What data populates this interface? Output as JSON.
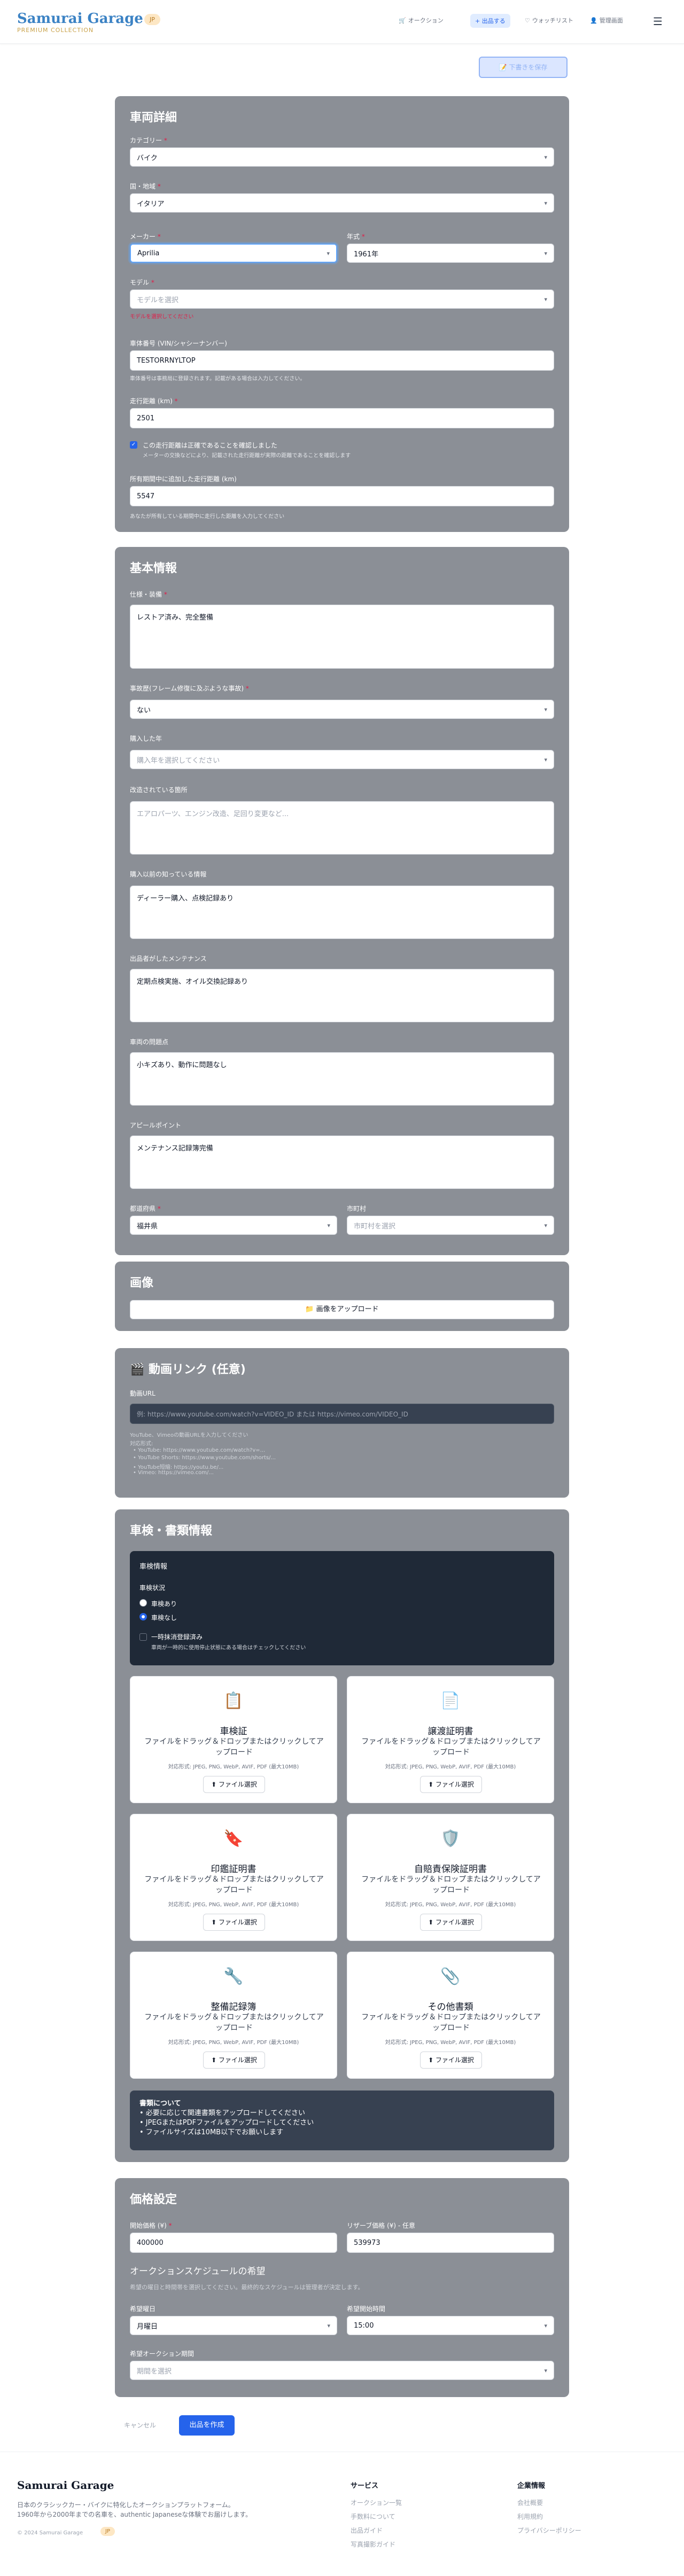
{
  "header": {
    "logo": "Samurai Garage",
    "subtitle": "PREMIUM COLLECTION",
    "badge": "JP",
    "nav": [
      {
        "icon": "🛒",
        "label": "オークション"
      },
      {
        "icon": "+",
        "label": "出品する"
      },
      {
        "icon": "♡",
        "label": "ウォッチリスト"
      },
      {
        "icon": "👤",
        "label": "管理画面"
      }
    ],
    "menu_icon": "☰"
  },
  "draft_button": "📝 下書きを保存",
  "vehicle": {
    "title": "車両詳細",
    "category_label": "カテゴリー",
    "category": "バイク",
    "country_label": "国・地域",
    "country": "イタリア",
    "maker_label": "メーカー",
    "maker": "Aprilia",
    "year_label": "年式",
    "year": "1961年",
    "model_label": "モデル",
    "model_placeholder": "モデルを選択",
    "model_error": "モデルを選択してください",
    "vin_label": "車体番号 (VIN/シャシーナンバー)",
    "vin": "TESTORRNYLTOP",
    "vin_hint": "車体番号は事務局に登録されます。記載がある場合は入力してください。",
    "mileage_label": "走行距離 (km)",
    "mileage": "2501",
    "confirm_label": "この走行距離は正確であることを確認しました",
    "confirm_hint": "メーターの交換などにより、記載された走行距離が実際の距離であることを確認します",
    "own_mileage_label": "所有期間中に追加した走行距離 (km)",
    "own_mileage": "5547",
    "own_hint": "あなたが所有している期間中に走行した距離を入力してください"
  },
  "basic": {
    "title": "基本情報",
    "spec_label": "仕様・装備",
    "spec": "レストア済み、完全整備",
    "accident_label": "事故歴(フレーム修復に及ぶような事故)",
    "accident": "ない",
    "purchase_label": "購入した年",
    "purchase_placeholder": "購入年を選択してください",
    "modified_label": "改造されている箇所",
    "modified_placeholder": "エアロパーツ、エンジン改造、足回り変更など...",
    "known_label": "購入以前の知っている情報",
    "known": "ディーラー購入、点検記録あり",
    "maint_label": "出品者がしたメンテナンス",
    "maint": "定期点検実施、オイル交換記録あり",
    "issues_label": "車両の問題点",
    "issues": "小キズあり、動作に問題なし",
    "appeal_label": "アピールポイント",
    "appeal": "メンテナンス記録簿完備",
    "pref_label": "都道府県",
    "pref": "福井県",
    "city_label": "市町村",
    "city_placeholder": "市町村を選択"
  },
  "images": {
    "title": "画像",
    "upload": "📁 画像をアップロード"
  },
  "video": {
    "title": "🎬 動画リンク (任意)",
    "url_label": "動画URL",
    "url_placeholder": "例: https://www.youtube.com/watch?v=VIDEO_ID または https://vimeo.com/VIDEO_ID",
    "help1": "YouTube、Vimeoの動画URLを入力してください",
    "help2": "対応形式:",
    "formats": [
      "• YouTube: https://www.youtube.com/watch?v=...",
      "• YouTube Shorts: https://www.youtube.com/shorts/...",
      "• YouTube短縮: https://youtu.be/...",
      "• Vimeo: https://vimeo.com/..."
    ]
  },
  "docs": {
    "title": "車検・書類情報",
    "inspection_title": "車検情報",
    "status_label": "車検状況",
    "opt1": "車検あり",
    "opt2": "車検なし",
    "opt3": "一時抹消登録済み",
    "opt3_hint": "車両が一時的に使用停止状態にある場合はチェックしてください",
    "cards": [
      {
        "icon": "📋",
        "title": "車検証"
      },
      {
        "icon": "📄",
        "title": "譲渡証明書"
      },
      {
        "icon": "🔖",
        "title": "印鑑証明書"
      },
      {
        "icon": "🛡️",
        "title": "自賠責保険証明書"
      },
      {
        "icon": "🔧",
        "title": "整備記録簿"
      },
      {
        "icon": "📎",
        "title": "その他書類"
      }
    ],
    "drop_text": "ファイルをドラッグ＆ドロップまたはクリックしてアップロード",
    "formats": "対応形式: JPEG, PNG, WebP, AVIF, PDF (最大10MB)",
    "select": "⬆ ファイル選択",
    "about_title": "書類について",
    "about": [
      "• 必要に応じて関連書類をアップロードしてください",
      "• JPEGまたはPDFファイルをアップロードしてください",
      "• ファイルサイズは10MB以下でお願いします"
    ]
  },
  "price": {
    "title": "価格設定",
    "start_label": "開始価格 (¥)",
    "start": "400000",
    "reserve_label": "リザーブ価格 (¥) - 任意",
    "reserve": "539973",
    "schedule_title": "オークションスケジュールの希望",
    "schedule_hint": "希望の曜日と時間帯を選択してください。最終的なスケジュールは管理者が決定します。",
    "day_label": "希望曜日",
    "day": "月曜日",
    "time_label": "希望開始時間",
    "time": "15:00",
    "period_label": "希望オークション期間",
    "period_placeholder": "期間を選択"
  },
  "actions": {
    "cancel": "キャンセル",
    "create": "出品を作成"
  },
  "footer": {
    "logo": "Samurai Garage",
    "desc1": "日本のクラシックカー・バイクに特化したオークションプラットフォーム。",
    "desc2": "1960年から2000年までの名車を、authentic Japaneseな体験でお届けします。",
    "copy": "© 2024 Samurai Garage",
    "badge": "JP",
    "col1_title": "サービス",
    "col1": [
      "オークション一覧",
      "手数料について",
      "出品ガイド",
      "写真撮影ガイド"
    ],
    "col2_title": "企業情報",
    "col2": [
      "会社概要",
      "利用規約",
      "プライバシーポリシー"
    ]
  }
}
